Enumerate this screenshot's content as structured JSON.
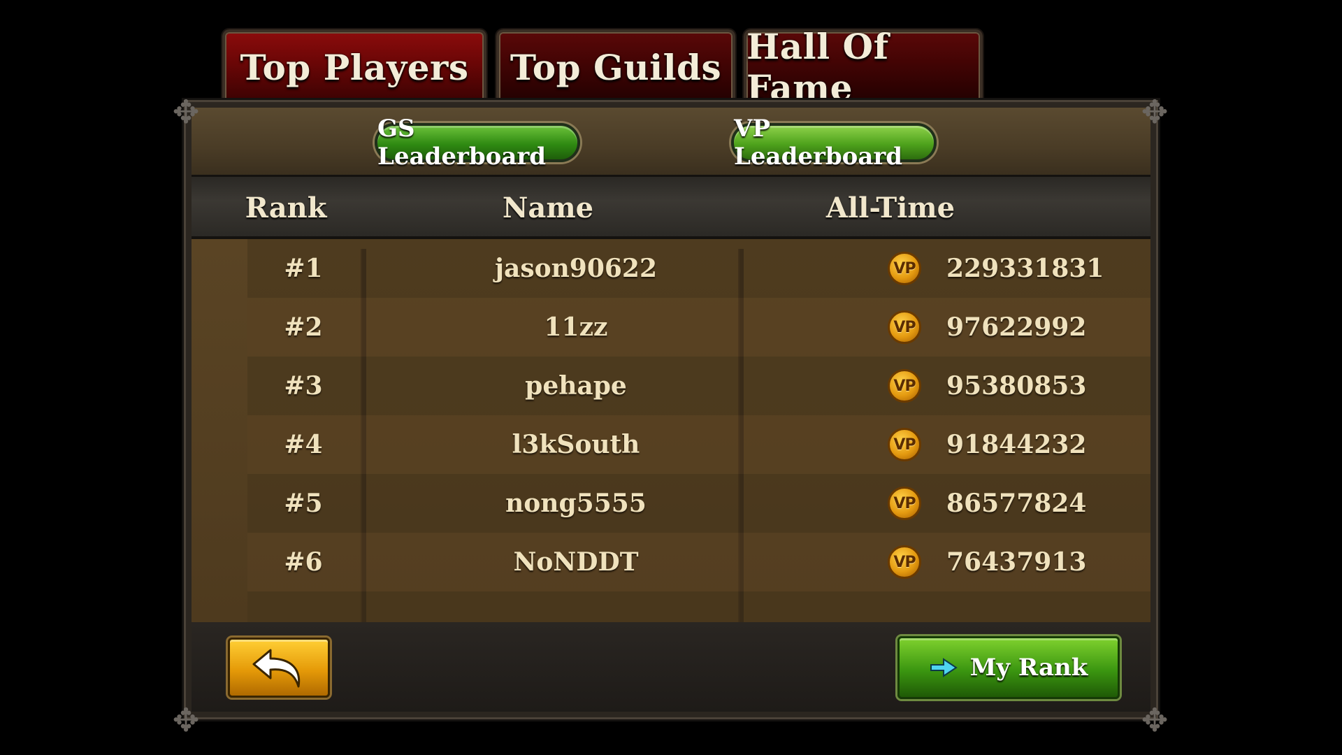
{
  "tabs": [
    {
      "label": "Top Players",
      "active": true
    },
    {
      "label": "Top Guilds",
      "active": false
    },
    {
      "label": "Hall Of Fame",
      "active": false
    }
  ],
  "leaderboard_buttons": {
    "gs": "GS Leaderboard",
    "vp": "VP Leaderboard"
  },
  "columns": {
    "rank": "Rank",
    "name": "Name",
    "all_time": "All-Time"
  },
  "rows": [
    {
      "rank": "#1",
      "name": "jason90622",
      "icon": "vp-coin-icon",
      "icon_text": "VP",
      "score": "229331831"
    },
    {
      "rank": "#2",
      "name": "11zz",
      "icon": "vp-coin-icon",
      "icon_text": "VP",
      "score": "97622992"
    },
    {
      "rank": "#3",
      "name": "pehape",
      "icon": "vp-coin-icon",
      "icon_text": "VP",
      "score": "95380853"
    },
    {
      "rank": "#4",
      "name": "l3kSouth",
      "icon": "vp-coin-icon",
      "icon_text": "VP",
      "score": "91844232"
    },
    {
      "rank": "#5",
      "name": "nong5555",
      "icon": "vp-coin-icon",
      "icon_text": "VP",
      "score": "86577824"
    },
    {
      "rank": "#6",
      "name": "NoNDDT",
      "icon": "vp-coin-icon",
      "icon_text": "VP",
      "score": "76437913"
    }
  ],
  "footer": {
    "back_icon": "back-arrow-icon",
    "my_rank_label": "My Rank",
    "my_rank_icon": "right-arrow-icon"
  },
  "colors": {
    "tab_red": "#7a0808",
    "button_green": "#3b9610",
    "button_gold": "#e59a08",
    "text_cream": "#f0e2bd"
  }
}
